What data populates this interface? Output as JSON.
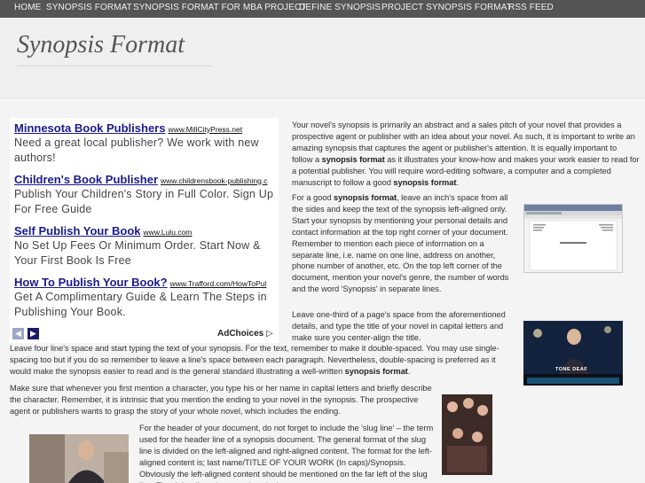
{
  "nav": {
    "items": [
      {
        "label": "HOME"
      },
      {
        "label": "SYNOPSIS FORMAT"
      },
      {
        "label": "SYNOPSIS FORMAT FOR MBA PROJECT"
      },
      {
        "label": "DEFINE SYNOPSIS"
      },
      {
        "label": "PROJECT SYNOPSIS FORMAT"
      },
      {
        "label": "RSS FEED"
      }
    ]
  },
  "header": {
    "site_title": "Synopsis Format"
  },
  "ads": {
    "items": [
      {
        "title": "Minnesota Book Publishers",
        "url": "www.MillCityPress.net",
        "desc": "Need a great local publisher? We work with new authors!"
      },
      {
        "title": "Children's Book Publisher",
        "url": "www.childrensbook-publishing.c",
        "desc": "Publish Your Children's Story in Full Color. Sign Up For Free Guide"
      },
      {
        "title": "Self Publish Your Book",
        "url": "www.Lulu.com",
        "desc": "No Set Up Fees Or Minimum Order. Start Now & Your First Book Is Free"
      },
      {
        "title": "How To Publish Your Book?",
        "url": "www.Trafford.com/HowToPul",
        "desc": "Get A Complimentary Guide & Learn The Steps in Publishing Your Book."
      }
    ],
    "prev_icon": "◀",
    "next_icon": "▶",
    "adchoices": "AdChoices ▷"
  },
  "article": {
    "p1_a": "Your novel's synopsis is primarily an abstract and a sales pitch of your novel that provides a prospective agent or publisher with an idea about your novel. As such, it is important to write an amazing synopsis that captures the agent or publisher's attention. It is equally important to follow a ",
    "p1_b": "synopsis format",
    "p1_c": " as it illustrates your know-how and makes your work easier to read for a potential publisher. You will require word-editing software, a computer and a completed manuscript to follow a good ",
    "p1_d": "synopsis format",
    "p1_e": ".",
    "p2_a": "For a good ",
    "p2_b": "synopsis format",
    "p2_c": ", leave an inch's space from all the sides and keep the text of the synopsis left-aligned only. Start your synopsis by mentioning your personal details and contact information at the top right corner of your document. Remember to mention each piece of information on a separate line, i.e. name on one line, address on another, phone number of another, etc. On the top left corner of the document, mention your novel's genre, the number of words and the word 'Synopsis' in separate lines.",
    "p3": "Leave one-third of a page's space from the aforementioned details, and type the title of your novel in capital letters and make sure you center-align the title.",
    "p4_a": "Leave four line's space and start typing the text of your synopsis. For the text, remember to make it double-spaced. You may use single-spacing too but if you do so remember to leave a line's space between each paragraph. Nevertheless, double-spacing is preferred as it would make the synopsis easier to read and is the general standard illustrating a well-written ",
    "p4_b": "synopsis format",
    "p4_c": ".",
    "p5": "Make sure that whenever you first mention a character, you type his or her name in capital letters and briefly describe the character. Remember, it is intrinsic that you mention the ending to your novel in the synopsis. The prospective agent or publishers wants to grasp the story of your whole novel, which includes the ending.",
    "p6": "For the header of your document, do not forget to include the 'slug line' – the term used for the header line of a synopsis document. The general format of the slug line is divided on the left-aligned and right-aligned content. The format for the left-aligned content is; last name/TITLE OF YOUR WORK (In caps)/Synopsis. Obviously the left-aligned content should be mentioned on the far left of the slug line. The right-aligned content is only the"
  },
  "images": {
    "tone_deaf_caption": "TONE DEAF"
  }
}
